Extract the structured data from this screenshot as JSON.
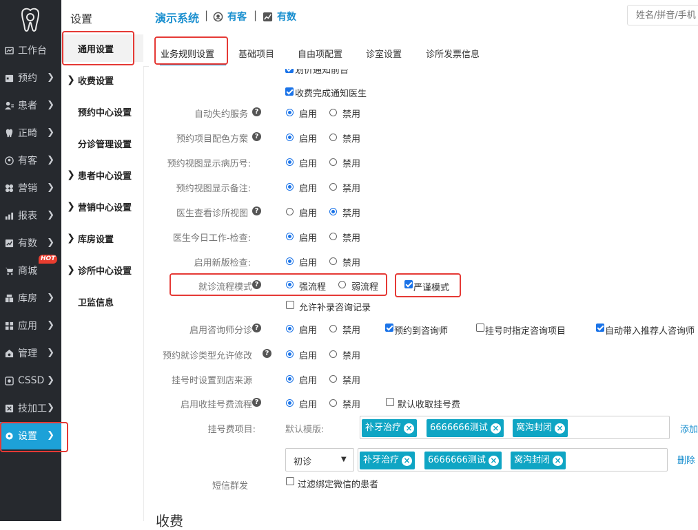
{
  "left_nav": {
    "items": [
      {
        "label": "工作台",
        "icon": "dashboard-icon",
        "has_arrow": false
      },
      {
        "label": "预约",
        "icon": "calendar-icon",
        "has_arrow": true
      },
      {
        "label": "患者",
        "icon": "patients-icon",
        "has_arrow": true
      },
      {
        "label": "正畸",
        "icon": "tooth-icon",
        "has_arrow": true
      },
      {
        "label": "有客",
        "icon": "customer-icon",
        "has_arrow": true
      },
      {
        "label": "营销",
        "icon": "marketing-icon",
        "has_arrow": true
      },
      {
        "label": "报表",
        "icon": "report-icon",
        "has_arrow": true
      },
      {
        "label": "有数",
        "icon": "chart-icon",
        "has_arrow": true
      },
      {
        "label": "商城",
        "icon": "cart-icon",
        "has_arrow": false,
        "badge": "HOT"
      },
      {
        "label": "库房",
        "icon": "warehouse-icon",
        "has_arrow": true
      },
      {
        "label": "应用",
        "icon": "apps-icon",
        "has_arrow": true
      },
      {
        "label": "管理",
        "icon": "manage-icon",
        "has_arrow": true
      },
      {
        "label": "CSSD",
        "icon": "cssd-icon",
        "has_arrow": true
      },
      {
        "label": "技加工",
        "icon": "lab-icon",
        "has_arrow": true
      },
      {
        "label": "设置",
        "icon": "gear-icon",
        "has_arrow": true,
        "active": true
      }
    ]
  },
  "submenu": {
    "title": "设置",
    "items": [
      {
        "label": "通用设置",
        "has_arrow": false,
        "active": true
      },
      {
        "label": "收费设置",
        "has_arrow": true
      },
      {
        "label": "预约中心设置",
        "has_arrow": false
      },
      {
        "label": "分诊管理设置",
        "has_arrow": false
      },
      {
        "label": "患者中心设置",
        "has_arrow": true
      },
      {
        "label": "营销中心设置",
        "has_arrow": true
      },
      {
        "label": "库房设置",
        "has_arrow": true
      },
      {
        "label": "诊所中心设置",
        "has_arrow": true
      },
      {
        "label": "卫监信息",
        "has_arrow": false
      }
    ]
  },
  "topbar": {
    "brand": "演示系统",
    "sep": "|",
    "link1": "有客",
    "link2": "有数",
    "search_placeholder": "姓名/拼音/手机"
  },
  "tabs": [
    "业务规则设置",
    "基础项目",
    "自由项配置",
    "诊室设置",
    "诊所发票信息"
  ],
  "content": {
    "top_cut_text": "划价通知前台",
    "top_checkbox": "收费完成通知医生",
    "opt_enable": "启用",
    "opt_disable": "禁用",
    "rows": [
      {
        "label": "自动失约服务",
        "help": true,
        "value": "启用"
      },
      {
        "label": "预约项目配色方案",
        "help": true,
        "value": "启用"
      },
      {
        "label": "预约视图显示病历号:",
        "help": false,
        "value": "启用"
      },
      {
        "label": "预约视图显示备注:",
        "help": false,
        "value": "启用"
      },
      {
        "label": "医生查看诊所视图",
        "help": true,
        "value": "禁用"
      },
      {
        "label": "医生今日工作-检查:",
        "help": false,
        "value": "启用"
      },
      {
        "label": "启用新版检查:",
        "help": false,
        "value": "启用"
      }
    ],
    "flow": {
      "label": "就诊流程模式",
      "opt_strong": "强流程",
      "opt_weak": "弱流程",
      "value": "强流程",
      "strict_label": "严谨模式",
      "strict_checked": true,
      "allow_supplement": "允许补录咨询记录",
      "allow_supplement_checked": false
    },
    "consult": {
      "label": "启用咨询师分诊",
      "value": "启用",
      "checks": [
        {
          "label": "预约到咨询师",
          "checked": true
        },
        {
          "label": "挂号时指定咨询项目",
          "checked": false
        },
        {
          "label": "自动带入推荐人咨询师",
          "checked": true
        }
      ]
    },
    "visit_type": {
      "label": "预约就诊类型允许修改",
      "value": "启用"
    },
    "source": {
      "label": "挂号时设置到店来源",
      "value": "启用"
    },
    "reg_fee_flow": {
      "label": "启用收挂号费流程",
      "value": "启用",
      "default_fee_label": "默认收取挂号费",
      "default_fee_checked": false
    },
    "reg_fee_items": {
      "label": "挂号费项目:",
      "default_template_label": "默认模版:",
      "default_tags": [
        "补牙治疗",
        "6666666测试",
        "窝沟封闭"
      ],
      "add_link": "添加",
      "select_value": "初诊",
      "select_tags": [
        "补牙治疗",
        "6666666测试",
        "窝沟封闭"
      ],
      "delete_link": "删除"
    },
    "sms": {
      "label": "短信群发",
      "filter_label": "过滤绑定微信的患者",
      "filter_checked": false
    },
    "next_section": "收费"
  }
}
